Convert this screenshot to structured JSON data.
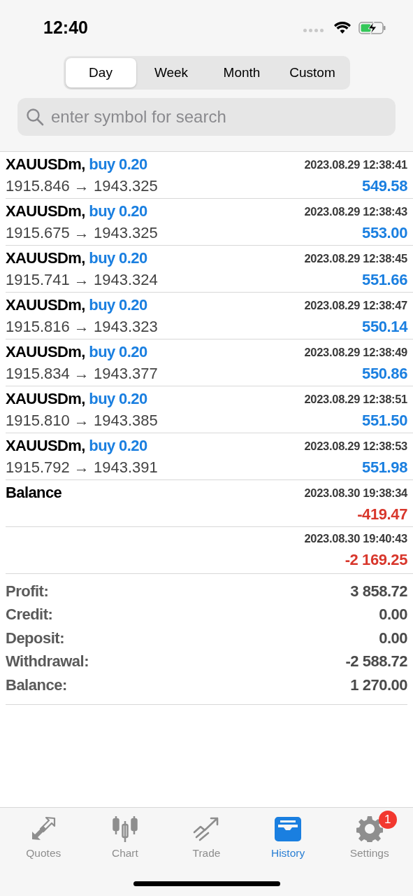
{
  "status_bar": {
    "time": "12:40"
  },
  "period_tabs": [
    {
      "label": "Day",
      "selected": true
    },
    {
      "label": "Week",
      "selected": false
    },
    {
      "label": "Month",
      "selected": false
    },
    {
      "label": "Custom",
      "selected": false
    }
  ],
  "search": {
    "placeholder": "enter symbol for search"
  },
  "deals": [
    {
      "kind": "trade",
      "symbol": "XAUUSDm,",
      "side": "buy 0.20",
      "prices": "1915.846 → 1943.325",
      "time": "2023.08.29 12:38:41",
      "amount": "549.58",
      "color": "#1a7fe0"
    },
    {
      "kind": "trade",
      "symbol": "XAUUSDm,",
      "side": "buy 0.20",
      "prices": "1915.675 → 1943.325",
      "time": "2023.08.29 12:38:43",
      "amount": "553.00",
      "color": "#1a7fe0"
    },
    {
      "kind": "trade",
      "symbol": "XAUUSDm,",
      "side": "buy 0.20",
      "prices": "1915.741 → 1943.324",
      "time": "2023.08.29 12:38:45",
      "amount": "551.66",
      "color": "#1a7fe0"
    },
    {
      "kind": "trade",
      "symbol": "XAUUSDm,",
      "side": "buy 0.20",
      "prices": "1915.816 → 1943.323",
      "time": "2023.08.29 12:38:47",
      "amount": "550.14",
      "color": "#1a7fe0"
    },
    {
      "kind": "trade",
      "symbol": "XAUUSDm,",
      "side": "buy 0.20",
      "prices": "1915.834 → 1943.377",
      "time": "2023.08.29 12:38:49",
      "amount": "550.86",
      "color": "#1a7fe0"
    },
    {
      "kind": "trade",
      "symbol": "XAUUSDm,",
      "side": "buy 0.20",
      "prices": "1915.810 → 1943.385",
      "time": "2023.08.29 12:38:51",
      "amount": "551.50",
      "color": "#1a7fe0"
    },
    {
      "kind": "trade",
      "symbol": "XAUUSDm,",
      "side": "buy 0.20",
      "prices": "1915.792 → 1943.391",
      "time": "2023.08.29 12:38:53",
      "amount": "551.98",
      "color": "#1a7fe0"
    },
    {
      "kind": "balance",
      "title": "Balance",
      "time": "2023.08.30 19:38:34",
      "amount": "-419.47",
      "color": "#d8372c"
    },
    {
      "kind": "balance",
      "time": "2023.08.30 19:40:43",
      "amount": "-2 169.25",
      "color": "#d8372c"
    }
  ],
  "summary": [
    {
      "label": "Profit:",
      "value": "3 858.72"
    },
    {
      "label": "Credit:",
      "value": "0.00"
    },
    {
      "label": "Deposit:",
      "value": "0.00"
    },
    {
      "label": "Withdrawal:",
      "value": "-2 588.72"
    },
    {
      "label": "Balance:",
      "value": "1 270.00"
    }
  ],
  "tab_bar": [
    {
      "label": "Quotes",
      "kind": "quotes",
      "selected": false
    },
    {
      "label": "Chart",
      "kind": "chart",
      "selected": false
    },
    {
      "label": "Trade",
      "kind": "trade",
      "selected": false
    },
    {
      "label": "History",
      "kind": "history",
      "selected": true
    },
    {
      "label": "Settings",
      "kind": "settings",
      "selected": false,
      "badge": "1"
    }
  ]
}
